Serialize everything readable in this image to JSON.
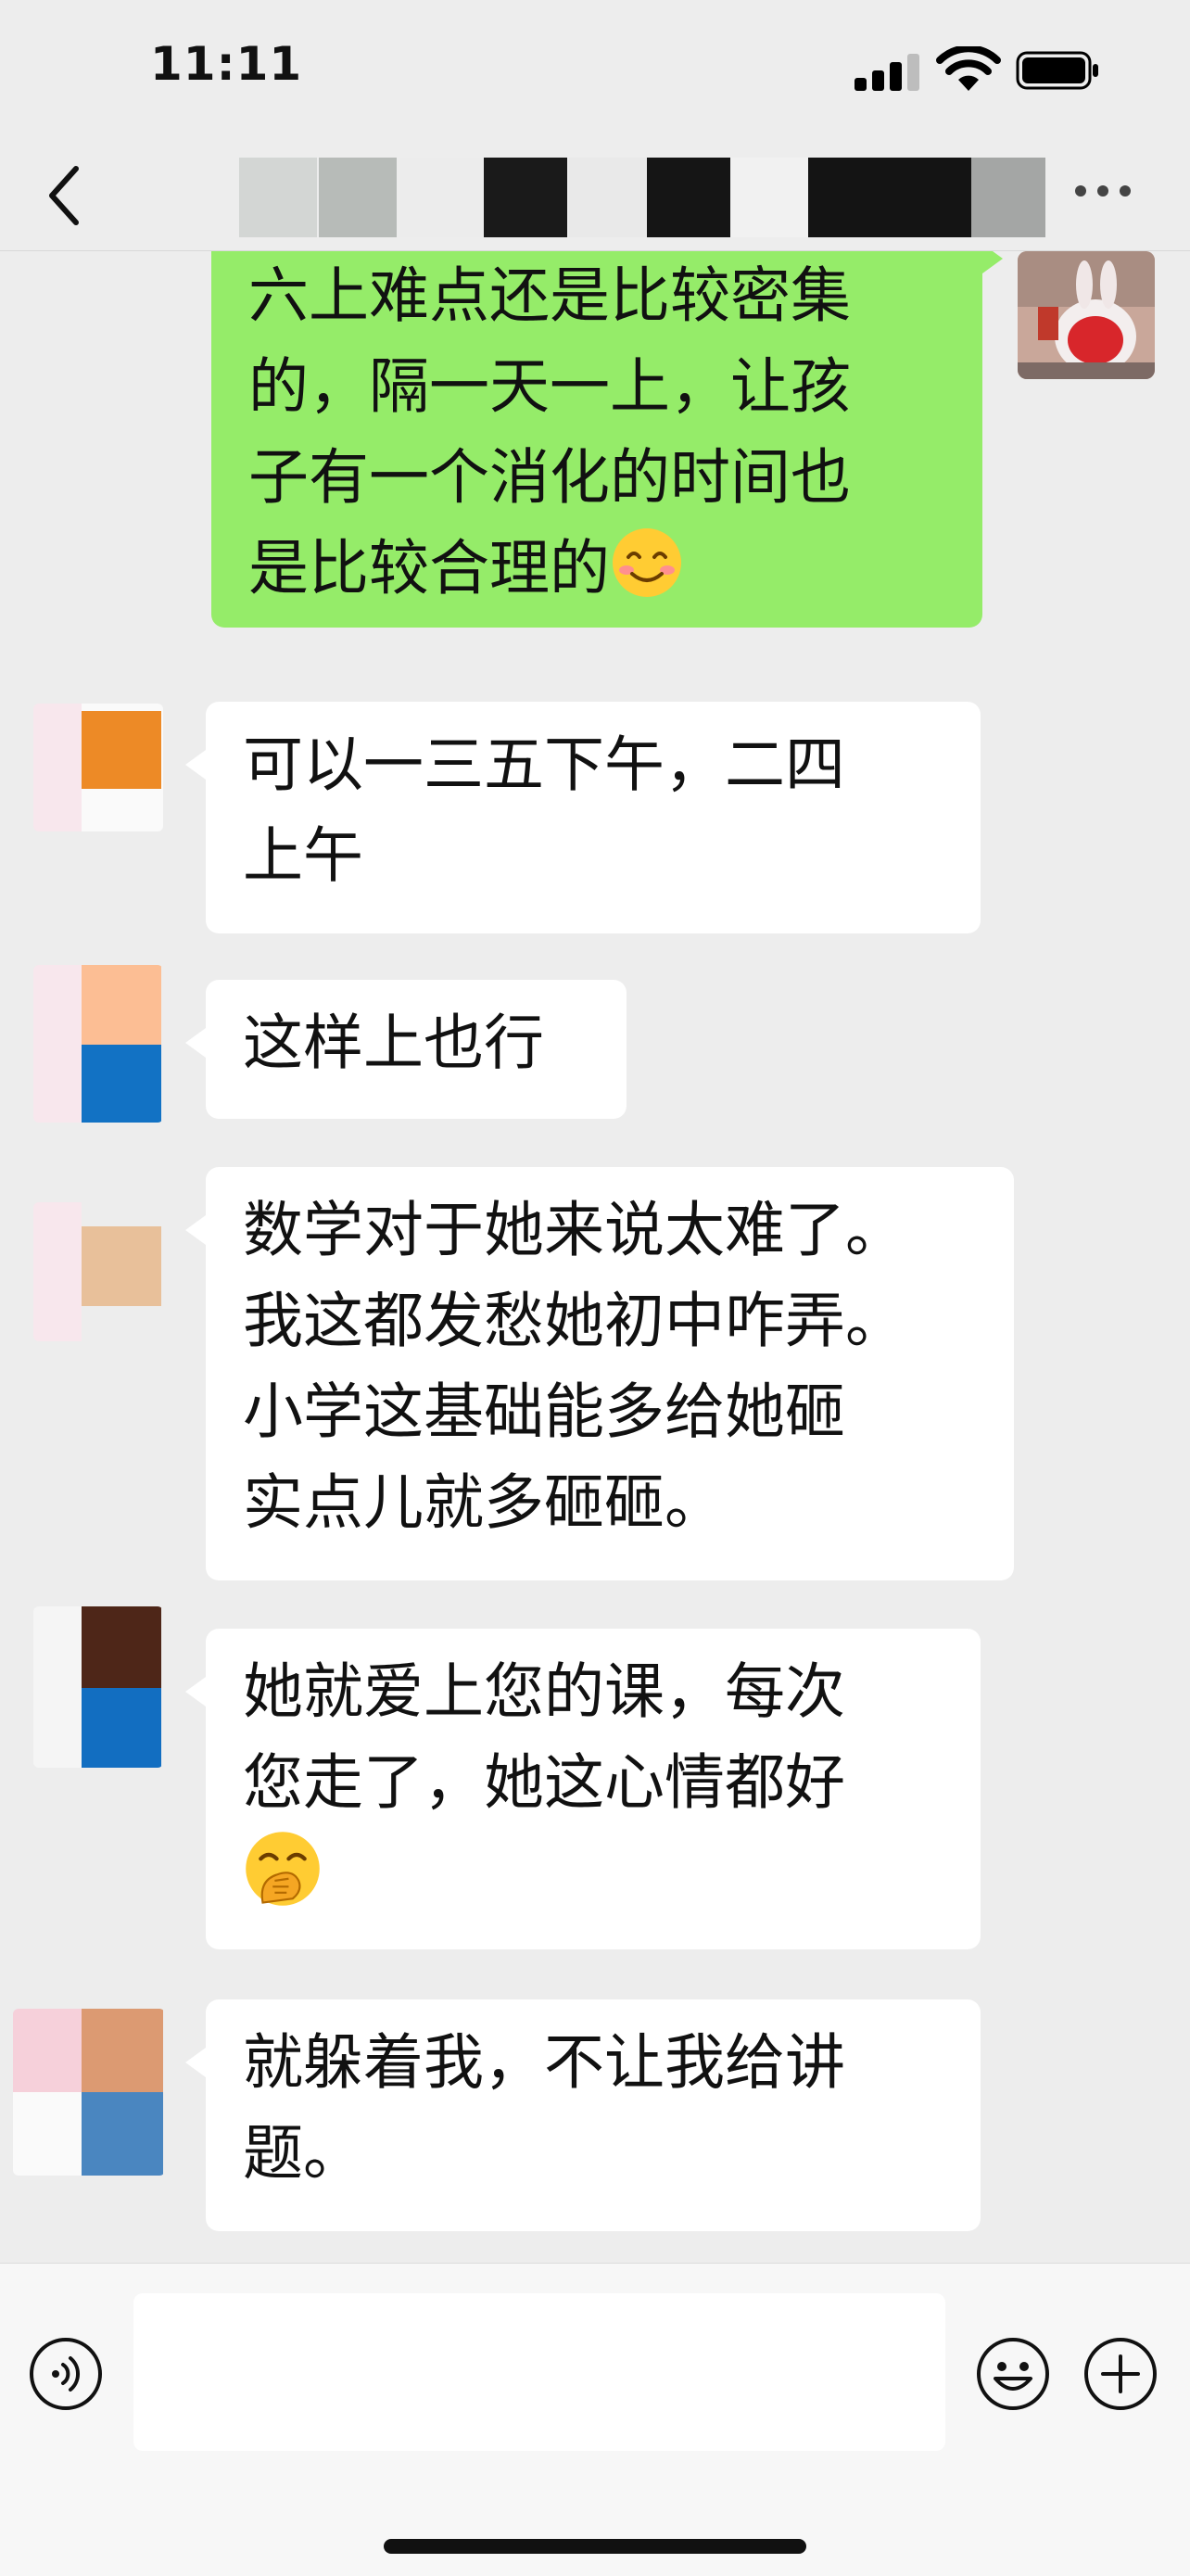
{
  "status_bar": {
    "time": "11:11"
  },
  "nav_bar": {
    "title_blurred": true
  },
  "messages": [
    {
      "sender": "me",
      "lines": [
        "六上难点还是比较密集",
        "的，隔一天一上，让孩",
        "子有一个消化的时间也",
        "是比较合理的"
      ],
      "trailing_emoji": "smiling-face-emoji"
    },
    {
      "sender": "other",
      "lines": [
        "可以一三五下午，二四",
        "上午"
      ]
    },
    {
      "sender": "other",
      "lines": [
        "这样上也行"
      ]
    },
    {
      "sender": "other",
      "lines": [
        "数学对于她来说太难了。",
        "我这都发愁她初中咋弄。",
        "小学这基础能多给她砸",
        "实点儿就多砸砸。"
      ]
    },
    {
      "sender": "other",
      "lines": [
        "她就爱上您的课，每次",
        "您走了，她这心情都好",
        ""
      ],
      "trailing_emoji": "hand-over-mouth-emoji"
    },
    {
      "sender": "other",
      "lines": [
        "就躲着我，不让我给讲",
        "题。"
      ]
    }
  ],
  "input_bar": {
    "placeholder": "",
    "icons": [
      "voice-icon",
      "emoji-icon",
      "plus-icon"
    ]
  },
  "colors": {
    "background": "#ededed",
    "outgoing_bubble": "#95ec69",
    "incoming_bubble": "#ffffff"
  }
}
